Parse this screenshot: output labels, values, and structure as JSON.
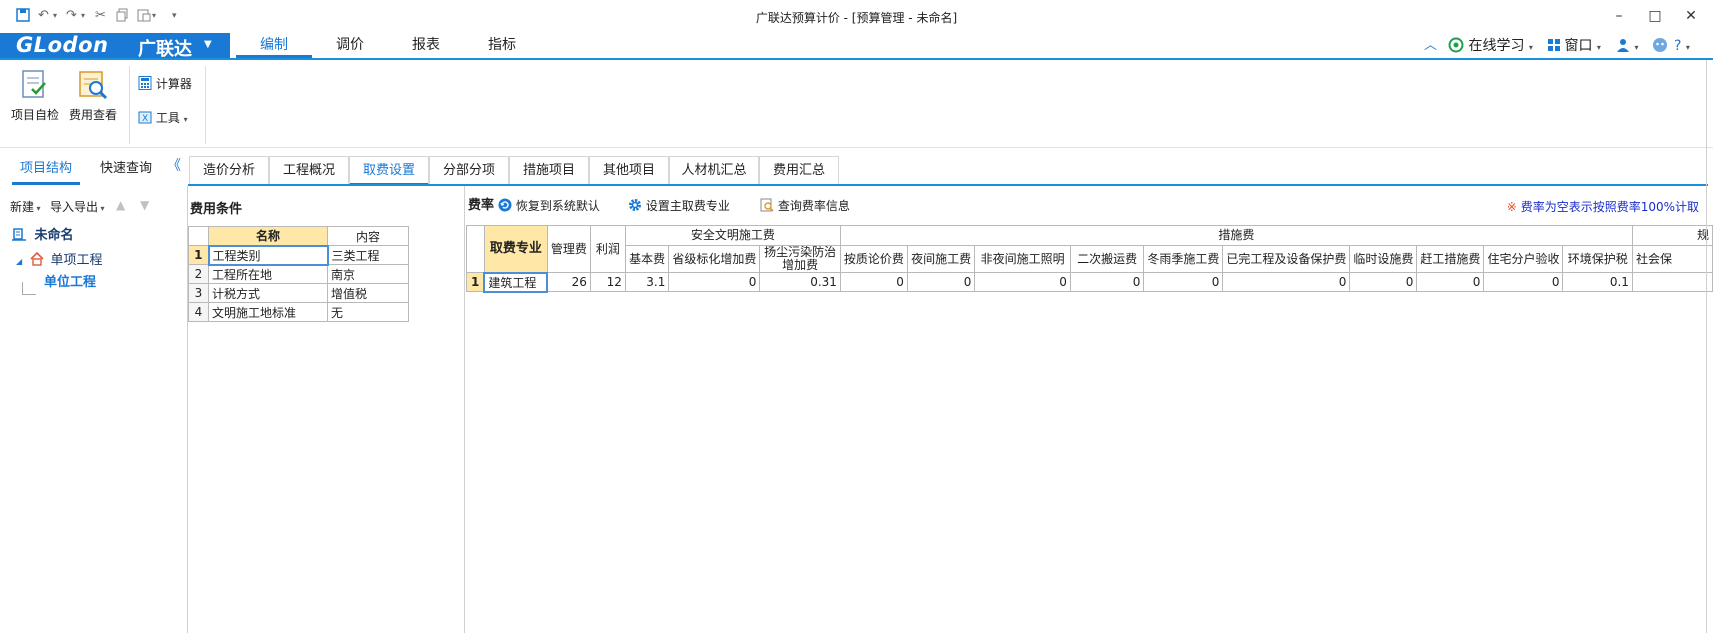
{
  "window": {
    "title": "广联达预算计价 - [预算管理 - 未命名]",
    "minimize": "–",
    "maximize": "□",
    "close": "✕"
  },
  "logo": {
    "en": "GLodon",
    "cn": "广联达",
    "arrow": "▼"
  },
  "menu": {
    "tabs": [
      "编制",
      "调价",
      "报表",
      "指标"
    ],
    "online_learning": "在线学习",
    "window_label": "窗口",
    "help": "?"
  },
  "ribbon": {
    "project_check": "项目自检",
    "fee_view": "费用查看",
    "calculator": "计算器",
    "tools": "工具"
  },
  "left_tabs": [
    "项目结构",
    "快速查询"
  ],
  "collapse_glyph": "《",
  "main_tabs": [
    "造价分析",
    "工程概况",
    "取费设置",
    "分部分项",
    "措施项目",
    "其他项目",
    "人材机汇总",
    "费用汇总"
  ],
  "left_panel": {
    "new_label": "新建",
    "import_export_label": "导入导出",
    "tree": {
      "root": "未命名",
      "single_project": "单项工程",
      "unit_project": "单位工程"
    }
  },
  "fee_conditions": {
    "title": "费用条件",
    "headers": {
      "name": "名称",
      "content": "内容"
    },
    "rows": [
      {
        "no": "1",
        "name": "工程类别",
        "content": "三类工程"
      },
      {
        "no": "2",
        "name": "工程所在地",
        "content": "南京"
      },
      {
        "no": "3",
        "name": "计税方式",
        "content": "增值税"
      },
      {
        "no": "4",
        "name": "文明施工地标准",
        "content": "无"
      }
    ]
  },
  "fee_rates": {
    "title": "费率",
    "restore_default": "恢复到系统默认",
    "set_main_specialty": "设置主取费专业",
    "query_rate_info": "查询费率信息",
    "note": "费率为空表示按照费率100%计取",
    "headers": {
      "specialty": "取费专业",
      "management": "管理费",
      "profit": "利润",
      "safety_group": "安全文明施工费",
      "base": "基本费",
      "provincial_bonus": "省级标化增加费",
      "dust_control_l1": "扬尘污染防治",
      "dust_control_l2": "增加费",
      "measures_group": "措施费",
      "tech_review": "按质论价费",
      "night_work": "夜间施工费",
      "non_night_lighting": "非夜间施工照明",
      "secondary_transport": "二次搬运费",
      "winter_rain": "冬雨季施工费",
      "protection": "已完工程及设备保护费",
      "temp_facilities": "临时设施费",
      "rush_measures": "赶工措施费",
      "residential_check": "住宅分户验收",
      "env_tax": "环境保护税",
      "social": "社会保",
      "regulation_group": "规"
    },
    "rows": [
      {
        "no": "1",
        "specialty": "建筑工程",
        "management": "26",
        "profit": "12",
        "base": "3.1",
        "provincial_bonus": "0",
        "dust_control": "0.31",
        "tech_review": "0",
        "night_work": "0",
        "non_night_lighting": "0",
        "secondary_transport": "0",
        "winter_rain": "0",
        "protection": "0",
        "temp_facilities": "0",
        "rush_measures": "0",
        "residential_check": "0",
        "env_tax": "0.1",
        "social": ""
      }
    ]
  },
  "colors": {
    "accent": "#1a79d4",
    "header_yellow": "#ffe7a8",
    "note_blue": "#1a2dcc"
  }
}
